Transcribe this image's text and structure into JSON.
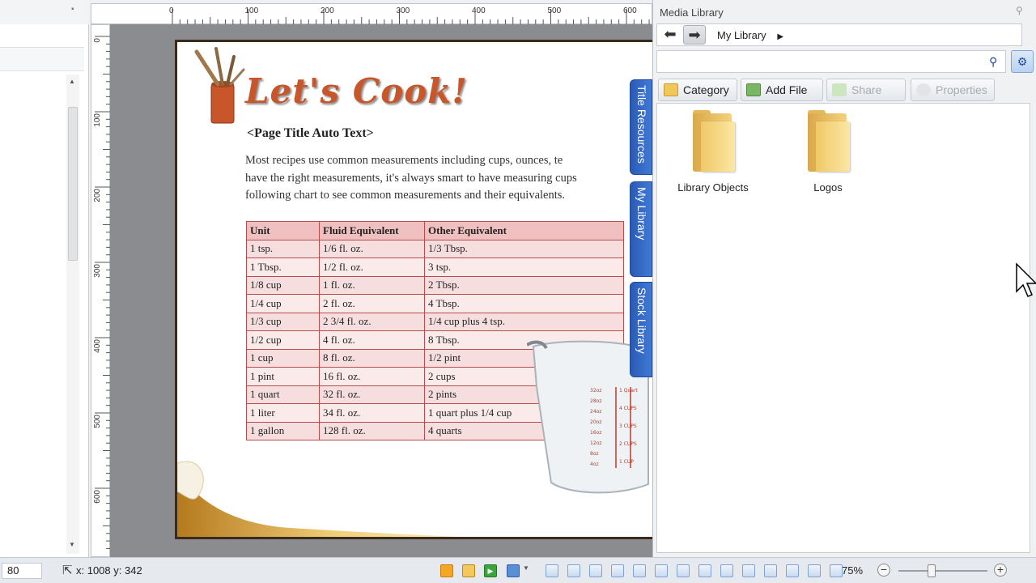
{
  "ruler": {
    "horizontal_labels": [
      "0",
      "100",
      "200",
      "300",
      "400",
      "500",
      "600"
    ],
    "vertical_labels": [
      "0",
      "100",
      "200",
      "300",
      "400",
      "500",
      "600"
    ]
  },
  "document": {
    "hero_title": "Let's Cook!",
    "page_title": "<Page Title Auto Text>",
    "intro_lines": [
      "Most recipes use common measurements including cups, ounces, te",
      "have the right measurements, it's always smart to have measuring cups",
      "following chart to see common measurements and their equivalents."
    ],
    "table": {
      "headers": [
        "Unit",
        "Fluid Equivalent",
        "Other Equivalent"
      ],
      "rows": [
        [
          "1 tsp.",
          "1/6 fl. oz.",
          "1/3 Tbsp."
        ],
        [
          "1 Tbsp.",
          "1/2 fl. oz.",
          "3 tsp."
        ],
        [
          "1/8 cup",
          "1 fl. oz.",
          "2 Tbsp."
        ],
        [
          "1/4 cup",
          "2 fl. oz.",
          "4 Tbsp."
        ],
        [
          "1/3 cup",
          "2 3/4 fl. oz.",
          "1/4 cup plus 4 tsp."
        ],
        [
          "1/2 cup",
          "4 fl. oz.",
          "8 Tbsp."
        ],
        [
          "1 cup",
          "8 fl. oz.",
          "1/2 pint"
        ],
        [
          "1 pint",
          "16 fl. oz.",
          "2 cups"
        ],
        [
          "1 quart",
          "32 fl. oz.",
          "2 pints"
        ],
        [
          "1 liter",
          "34 fl. oz.",
          "1 quart plus 1/4 cup"
        ],
        [
          "1 gallon",
          "128 fl. oz.",
          "4 quarts"
        ]
      ]
    },
    "measuring_cup_marks": [
      "32oz",
      "28oz",
      "24oz",
      "20oz",
      "16oz",
      "12oz",
      "8oz",
      "4oz",
      "1 Quart",
      "4 CUPS",
      "3 CUPS",
      "2 CUPS",
      "1 CUP"
    ]
  },
  "side_tabs": [
    "Title Resources",
    "My Library",
    "Stock Library"
  ],
  "media_library": {
    "title": "Media Library",
    "breadcrumb": "My Library",
    "search_value": "",
    "toolbar": {
      "category": "Category",
      "add_file": "Add File",
      "share": "Share",
      "properties": "Properties"
    },
    "folders": [
      "Library Objects",
      "Logos"
    ]
  },
  "status_bar": {
    "field_value": "80",
    "coords": "x: 1008  y: 342",
    "zoom": "75%"
  },
  "colors": {
    "accent_blue": "#2a5bb5",
    "title_orange": "#c9562a",
    "table_border": "#b94c4c",
    "table_header": "#f0c0c0"
  }
}
